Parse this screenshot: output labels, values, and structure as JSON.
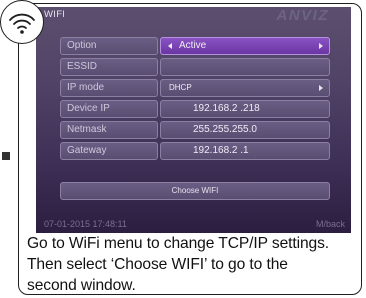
{
  "screen": {
    "title": "WIFI",
    "brand": "ANVIZ",
    "rows": [
      {
        "label": "Option",
        "value": "Active"
      },
      {
        "label": "ESSID",
        "value": ""
      },
      {
        "label": "IP mode",
        "value": "DHCP"
      },
      {
        "label": "Device IP",
        "value": "192.168.2  .218"
      },
      {
        "label": "Netmask",
        "value": "255.255.255.0"
      },
      {
        "label": "Gateway",
        "value": "192.168.2  .1"
      }
    ],
    "choose_button": "Choose WIFI",
    "status": {
      "datetime": "07-01-2015 17:48:11",
      "back": "M/back"
    }
  },
  "caption": {
    "line1": "Go to WiFi menu to change TCP/IP settings.",
    "line2": "Then select ‘Choose WIFI’ to go to the",
    "line3": "second window."
  },
  "icons": {
    "badge": "wifi-icon"
  },
  "colors": {
    "accent": "#7a45b5",
    "screen_bg": "#4a3d60"
  }
}
